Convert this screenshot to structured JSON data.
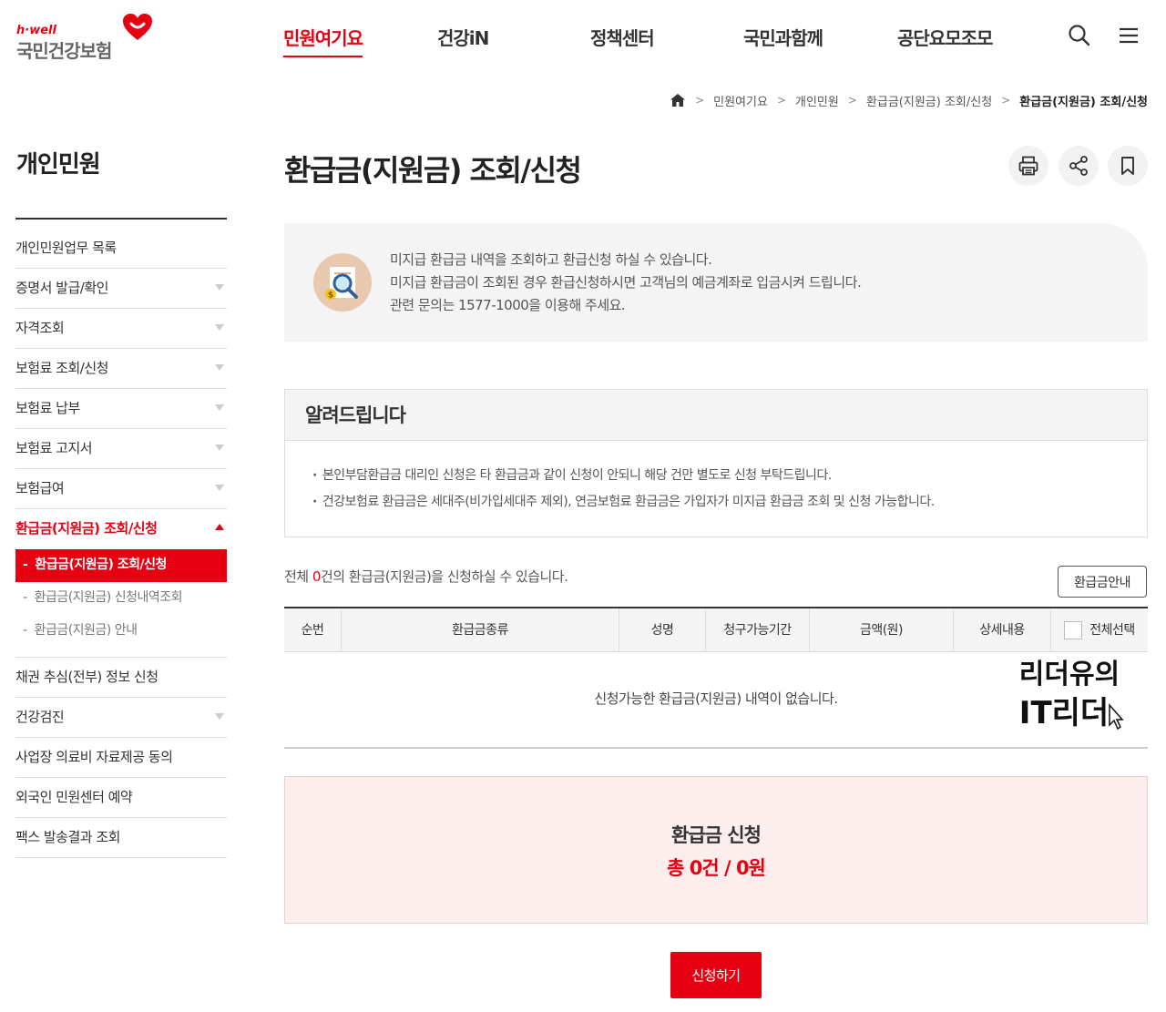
{
  "header": {
    "logo_sub": "h·well",
    "logo_main": "국민건강보험",
    "nav": [
      "민원여기요",
      "건강iN",
      "정책센터",
      "국민과함께",
      "공단요모조모"
    ],
    "active_nav": "민원여기요",
    "icons": [
      "search-icon",
      "menu-icon"
    ]
  },
  "breadcrumb": [
    "민원여기요",
    "개인민원",
    "환급금(지원금) 조회/신청",
    "환급금(지원금) 조회/신청"
  ],
  "sidebar": {
    "title": "개인민원",
    "items": [
      {
        "label": "개인민원업무 목록",
        "has_arrow": false
      },
      {
        "label": "증명서 발급/확인",
        "has_arrow": true
      },
      {
        "label": "자격조회",
        "has_arrow": true
      },
      {
        "label": "보험료 조회/신청",
        "has_arrow": true
      },
      {
        "label": "보험료 납부",
        "has_arrow": true
      },
      {
        "label": "보험료 고지서",
        "has_arrow": true
      },
      {
        "label": "보험급여",
        "has_arrow": true
      },
      {
        "label": "환급금(지원금) 조회/신청",
        "has_arrow": true,
        "open": true
      }
    ],
    "sub_items": [
      "환급금(지원금) 조회/신청",
      "환급금(지원금) 신청내역조회",
      "환급금(지원금) 안내"
    ],
    "items_after": [
      {
        "label": "채권 추심(전부) 정보 신청",
        "has_arrow": false
      },
      {
        "label": "건강검진",
        "has_arrow": true
      },
      {
        "label": "사업장 의료비 자료제공 동의",
        "has_arrow": false
      },
      {
        "label": "외국인 민원센터 예약",
        "has_arrow": false
      },
      {
        "label": "팩스 발송결과 조회",
        "has_arrow": false
      }
    ]
  },
  "page": {
    "title": "환급금(지원금) 조회/신청",
    "tools": [
      "print-icon",
      "share-icon",
      "bookmark-icon"
    ]
  },
  "intro": {
    "lines": [
      "미지급 환급금 내역을 조회하고 환급신청 하실 수 있습니다.",
      "미지급 환급금이 조회된 경우 환급신청하시면 고객님의 예금계좌로 입금시켜 드립니다.",
      "관련 문의는 1577-1000을 이용해 주세요."
    ]
  },
  "notice": {
    "title": "알려드립니다",
    "items": [
      "본인부담환급금 대리인 신청은 타 환급금과 같이 신청이 안되니 해당 건만 별도로 신청 부탁드립니다.",
      "건강보험료 환급금은 세대주(비가입세대주 제외), 연금보험료 환급금은 가입자가 미지급 환급금 조회 및 신청 가능합니다."
    ]
  },
  "summary": {
    "prefix": "전체 ",
    "count": "0",
    "suffix": "건의 환급금(지원금)을 신청하실 수 있습니다.",
    "guide_button": "환급금안내"
  },
  "table": {
    "columns": [
      "순번",
      "환급금종류",
      "성명",
      "청구가능기간",
      "금액(원)",
      "상세내용",
      "전체선택"
    ],
    "empty_message": "신청가능한 환급금(지원금) 내역이 없습니다."
  },
  "watermark": [
    "리더유의",
    "IT리더"
  ],
  "apply": {
    "title": "환급금 신청",
    "total": "총 0건 / 0원",
    "button": "신청하기"
  },
  "colors": {
    "accent": "#e60012",
    "panel": "#f4f4f4",
    "apply_bg": "#fdeeee"
  }
}
